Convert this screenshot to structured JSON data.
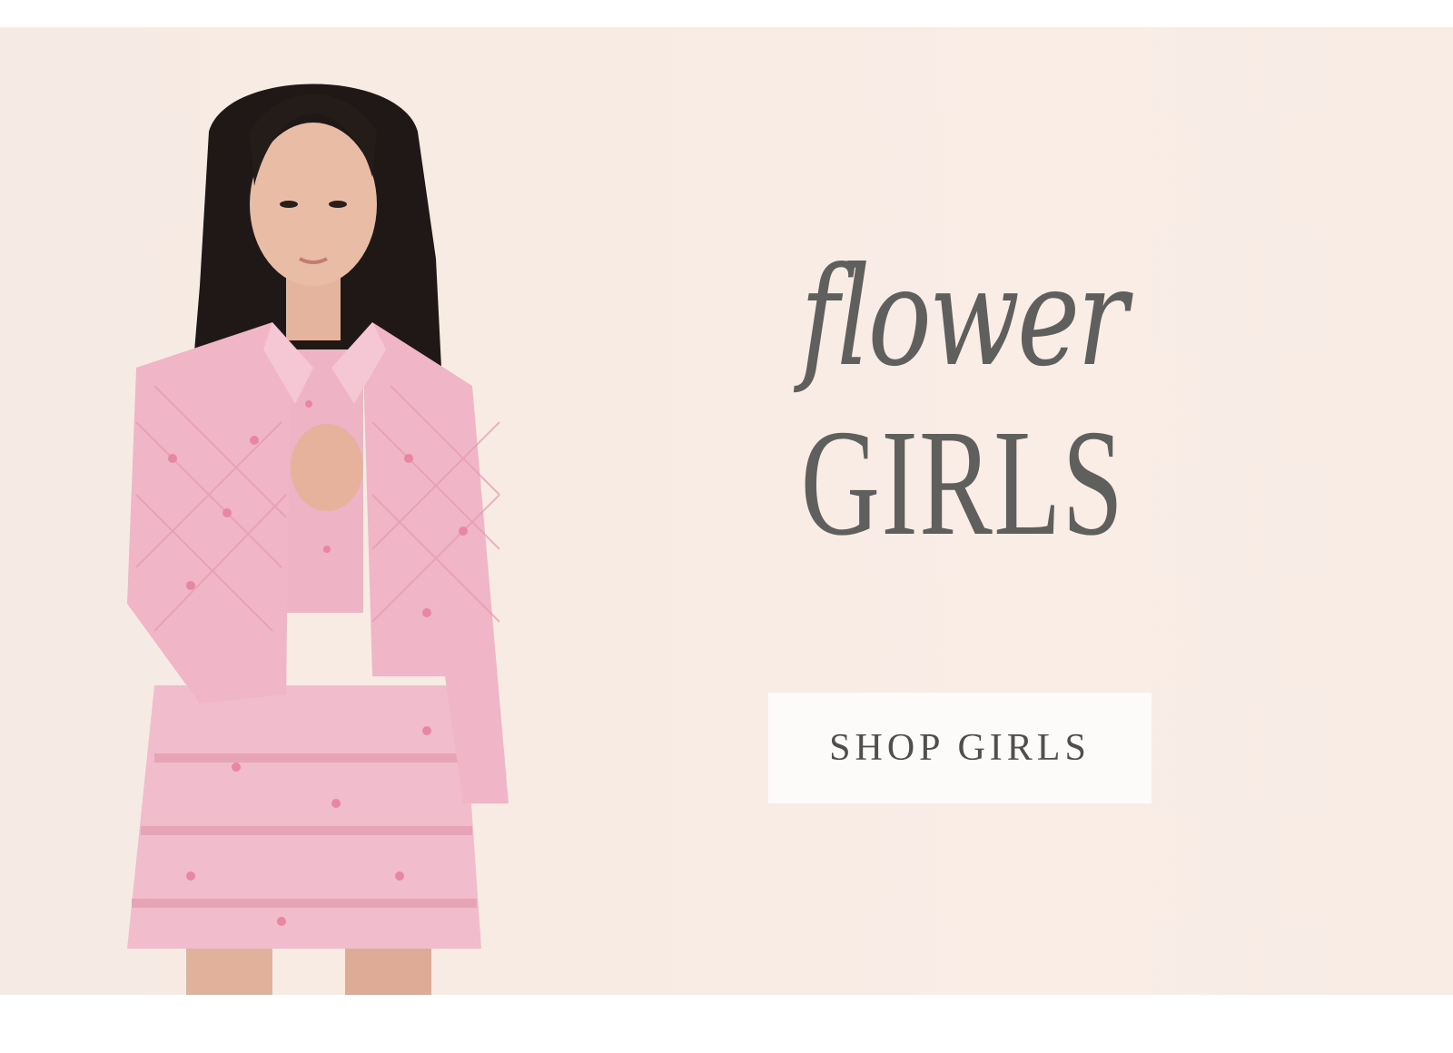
{
  "hero": {
    "script_title": "flower",
    "caps_title": "GIRLS",
    "cta_label": "SHOP GIRLS"
  },
  "colors": {
    "background": "#f8ece5",
    "title_text": "#5f605e",
    "button_bg": "#fdfbf9",
    "outfit_pink": "#f1b7c8"
  }
}
